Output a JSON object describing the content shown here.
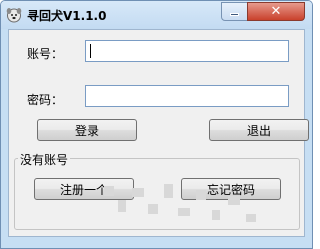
{
  "window": {
    "title": "寻回犬V1.1.0",
    "app_icon": "dog-face-icon",
    "minimize_icon": "minimize-icon",
    "close_icon": "close-icon",
    "close_glyph": "✕"
  },
  "form": {
    "account_label": "账号：",
    "account_value": "",
    "password_label": "密码：",
    "password_value": ""
  },
  "buttons": {
    "login": "登录",
    "exit": "退出"
  },
  "no_account_group": {
    "legend": "没有账号",
    "register": "注册一个",
    "forgot_password": "忘记密码"
  },
  "colors": {
    "title_bar": "#c6def3",
    "close_button": "#c9412c",
    "input_border": "#7a9cc4"
  }
}
